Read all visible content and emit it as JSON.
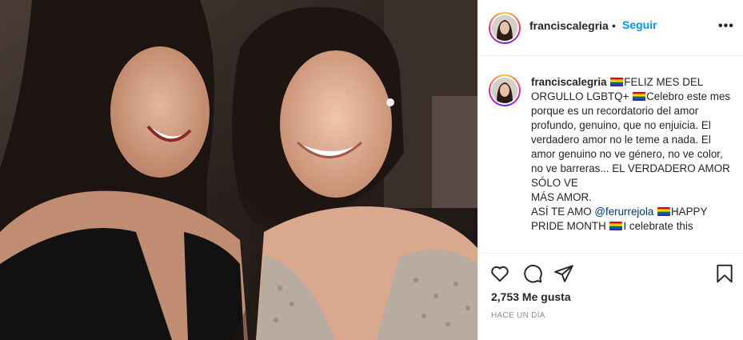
{
  "post": {
    "photo_alt": "two women smiling in a car",
    "username": "franciscalegria",
    "separator": "•",
    "follow_label": "Seguir",
    "more_label": "•••"
  },
  "caption": {
    "username": "franciscalegria",
    "segments": [
      {
        "type": "flag"
      },
      {
        "type": "text",
        "text": "FELIZ MES DEL ORGULLO LGBTQ+ "
      },
      {
        "type": "flag"
      },
      {
        "type": "text",
        "text": "Celebro este mes porque es un recordatorio del amor profundo, genuino, que no enjuicia. El verdadero amor no le teme a nada. El amor genuino no ve género, no ve color, no ve barreras... EL VERDADERO AMOR\nSÓLO VE\nMÁS AMOR.\nASÍ TE AMO "
      },
      {
        "type": "mention",
        "text": "@ferurrejola"
      },
      {
        "type": "text",
        "text": " "
      },
      {
        "type": "flag"
      },
      {
        "type": "text",
        "text": "HAPPY PRIDE MONTH "
      },
      {
        "type": "flag"
      },
      {
        "type": "text",
        "text": "I celebrate this"
      }
    ]
  },
  "actions": {
    "likes": "2,753 Me gusta",
    "time": "HACE UN DÍA"
  },
  "icons": {
    "like": "heart-icon",
    "comment": "comment-icon",
    "share": "share-icon",
    "save": "bookmark-icon"
  },
  "colors": {
    "link": "#0095f6",
    "mention": "#00376b",
    "muted": "#8e8e8e"
  }
}
